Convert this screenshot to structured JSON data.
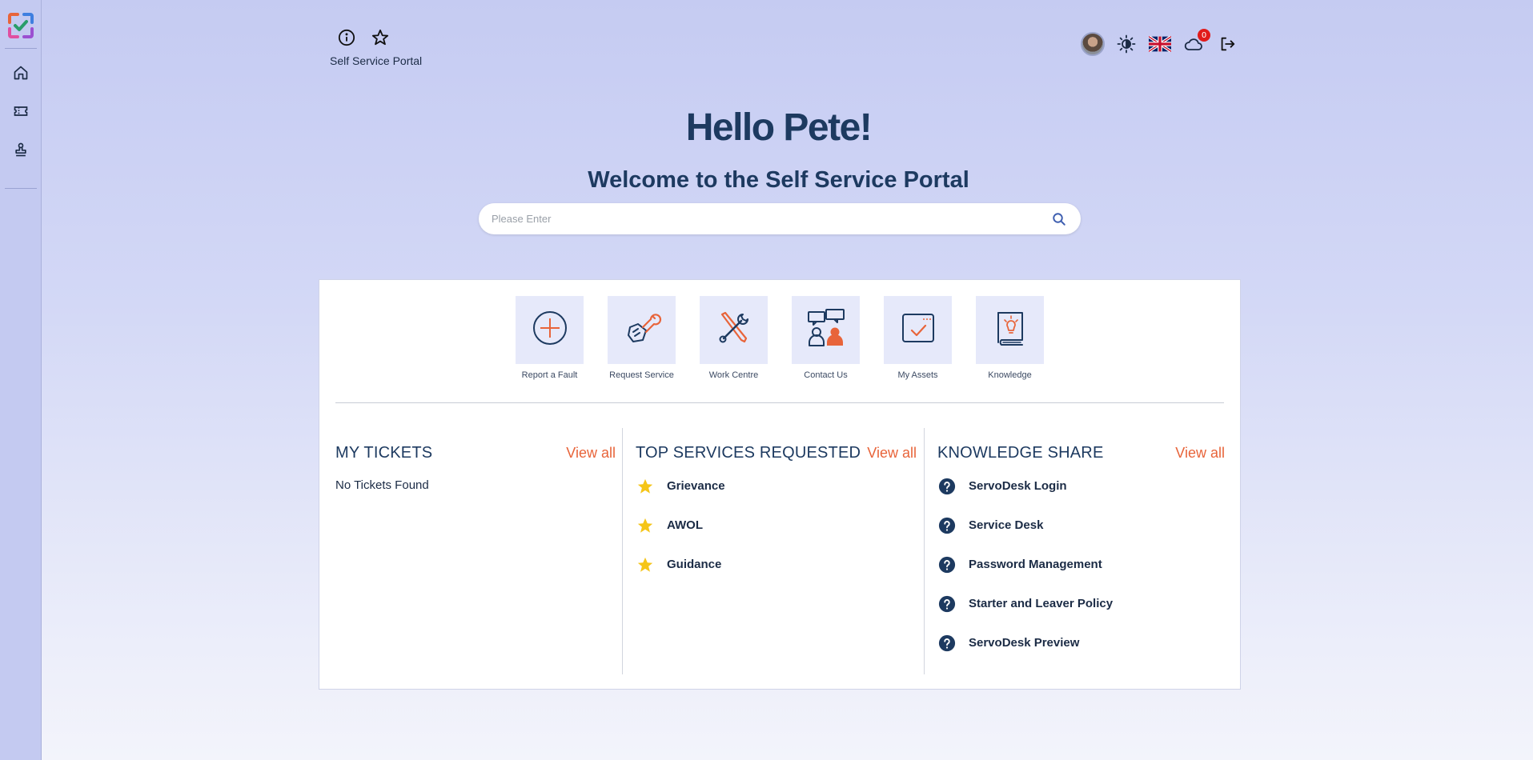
{
  "header": {
    "portal_label": "Self Service Portal",
    "notifications_count": "0"
  },
  "hero": {
    "title": "Hello Pete!",
    "subtitle": "Welcome to the Self Service Portal"
  },
  "search": {
    "placeholder": "Please Enter",
    "value": ""
  },
  "tiles": [
    {
      "label": "Report a Fault",
      "icon": "plus-circle-icon"
    },
    {
      "label": "Request Service",
      "icon": "hand-wrench-icon"
    },
    {
      "label": "Work Centre",
      "icon": "tools-icon"
    },
    {
      "label": "Contact Us",
      "icon": "people-chat-icon"
    },
    {
      "label": "My Assets",
      "icon": "asset-check-icon"
    },
    {
      "label": "Knowledge",
      "icon": "book-bulb-icon"
    }
  ],
  "my_tickets": {
    "title": "MY TICKETS",
    "view_all": "View all",
    "empty_text": "No Tickets Found"
  },
  "top_services": {
    "title": "TOP SERVICES REQUESTED",
    "view_all": "View all",
    "items": [
      {
        "label": "Grievance",
        "icon": "star-icon"
      },
      {
        "label": "AWOL",
        "icon": "star-icon"
      },
      {
        "label": "Guidance",
        "icon": "star-icon"
      }
    ]
  },
  "knowledge_share": {
    "title": "KNOWLEDGE SHARE",
    "view_all": "View all",
    "items": [
      {
        "label": "ServoDesk Login",
        "icon": "question-icon"
      },
      {
        "label": "Service Desk",
        "icon": "question-icon"
      },
      {
        "label": "Password Management",
        "icon": "question-icon"
      },
      {
        "label": "Starter and Leaver Policy",
        "icon": "question-icon"
      },
      {
        "label": "ServoDesk Preview",
        "icon": "question-icon"
      }
    ]
  },
  "colors": {
    "accent": "#e8643a",
    "primary": "#1d3a60",
    "star": "#f5c518"
  }
}
